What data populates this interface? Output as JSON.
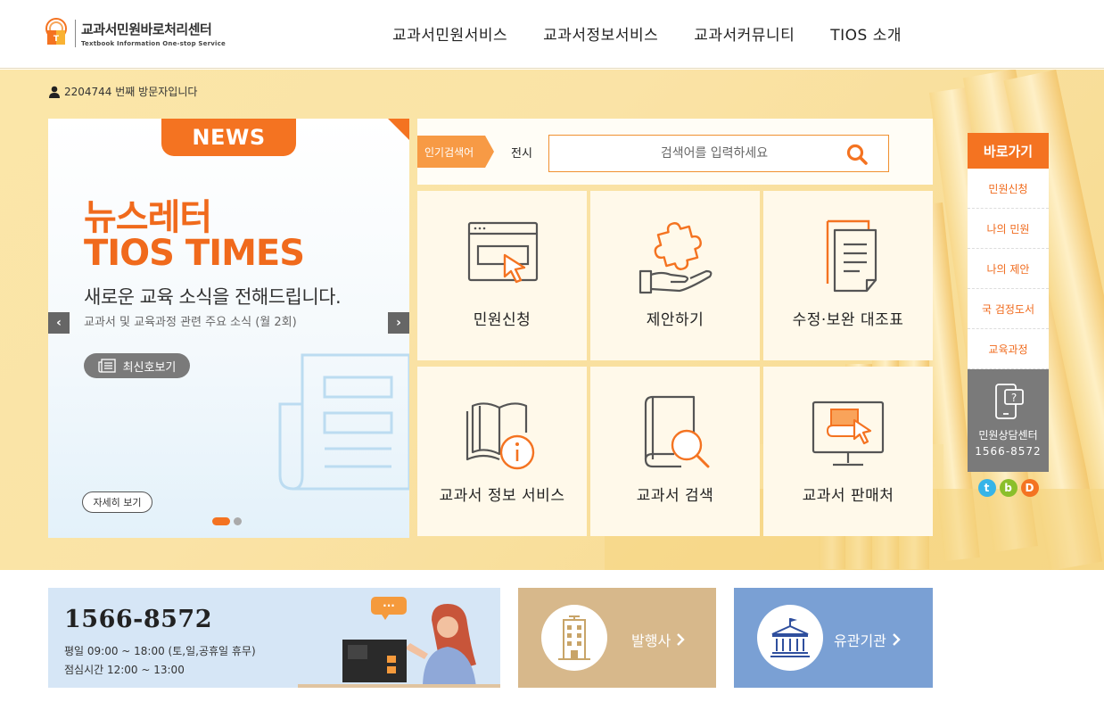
{
  "header": {
    "logo_title": "교과서민원바로처리센터",
    "logo_sub": "Textbook Information One-stop Service",
    "nav": [
      "교과서민원서비스",
      "교과서정보서비스",
      "교과서커뮤니티",
      "TIOS 소개"
    ]
  },
  "visitor": {
    "text": "2204744 번째 방문자입니다"
  },
  "news": {
    "tab": "NEWS",
    "title1": "뉴스레터",
    "title2": "TIOS TIMES",
    "desc": "새로운 교육 소식을 전해드립니다.",
    "sub": "교과서 및 교육과정 관련 주요 소식 (월 2회)",
    "latest_button": "최신호보기",
    "detail_button": "자세히 보기",
    "prev": "‹",
    "next": "›"
  },
  "search": {
    "popular_label": "인기검색어",
    "popular_word": "전시",
    "placeholder": "검색어를 입력하세요"
  },
  "tiles": [
    {
      "label": "민원신청",
      "icon": "browser-cursor-icon"
    },
    {
      "label": "제안하기",
      "icon": "puzzle-hand-icon"
    },
    {
      "label": "수정·보완 대조표",
      "icon": "documents-icon"
    },
    {
      "label": "교과서 정보 서비스",
      "icon": "book-info-icon"
    },
    {
      "label": "교과서 검색",
      "icon": "book-search-icon"
    },
    {
      "label": "교과서 판매처",
      "icon": "monitor-book-icon"
    }
  ],
  "quick": {
    "title": "바로가기",
    "items": [
      "민원신청",
      "나의 민원",
      "나의 제안",
      "국 검정도서",
      "교육과정"
    ],
    "call_title": "민원상담센터",
    "call_number": "1566-8572",
    "sns": [
      "t",
      "b",
      "D"
    ]
  },
  "bottom": {
    "phone": "1566-8572",
    "hours": "평일 09:00 ~ 18:00 (토,일,공휴일 휴무)",
    "lunch": "점심시간 12:00 ~ 13:00",
    "speech": "···",
    "publisher": "발행사",
    "agency": "유관기관"
  },
  "colors": {
    "accent": "#f47321",
    "hero_bg": "#fbe6a8",
    "tile_bg": "#fff9ea",
    "publisher_bg": "#d7b88b",
    "agency_bg": "#7aa0d4",
    "call_bg": "#d6e6f6"
  }
}
